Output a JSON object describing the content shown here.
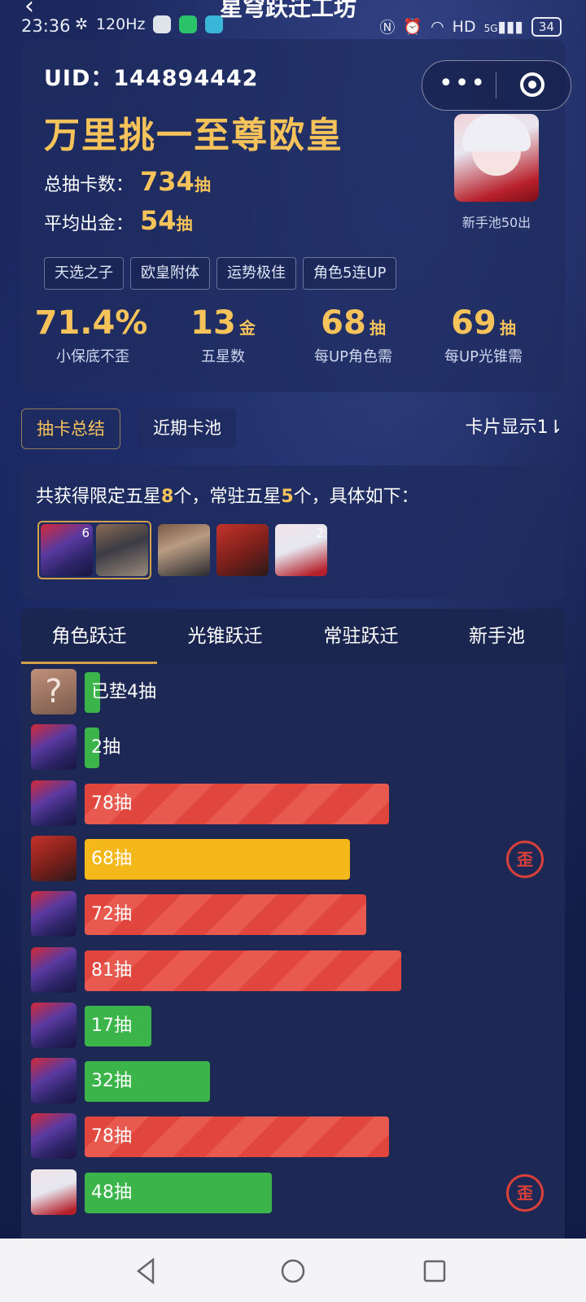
{
  "status_bar": {
    "time": "23:36",
    "refresh_rate": "120",
    "network": "5G",
    "battery": "34"
  },
  "header": {
    "title_partial": "星穹跃迁工坊"
  },
  "summary": {
    "uid_label": "UID：",
    "uid_value": "144894442",
    "rank_title": "万里挑一至尊欧皇",
    "total_pulls_label": "总抽卡数：",
    "total_pulls_value": "734",
    "total_pulls_unit": "抽",
    "avg_label": "平均出金：",
    "avg_value": "54",
    "avg_unit": "抽",
    "portrait_caption": "新手池50出",
    "tags": [
      "天选之子",
      "欧皇附体",
      "运势极佳",
      "角色5连UP"
    ],
    "metrics": [
      {
        "value": "71.4%",
        "unit": "",
        "label": "小保底不歪"
      },
      {
        "value": "13",
        "unit": "金",
        "label": "五星数"
      },
      {
        "value": "68",
        "unit": "抽",
        "label": "每UP角色需"
      },
      {
        "value": "69",
        "unit": "抽",
        "label": "每UP光锥需"
      }
    ]
  },
  "view_tabs": {
    "active": "抽卡总结",
    "other": "近期卡池",
    "card_display": "卡片显示1⇂"
  },
  "collection": {
    "text_prefix": "共获得限定五星",
    "limited_count": "8",
    "text_mid": "个，常驻五星",
    "standard_count": "5",
    "text_suffix": "个，具体如下：",
    "thumbs": [
      {
        "name": "seele",
        "badge": "6"
      },
      {
        "name": "lightcone",
        "badge": ""
      },
      {
        "name": "welt",
        "badge": ""
      },
      {
        "name": "himeko",
        "badge": ""
      },
      {
        "name": "white-hair",
        "badge": "2"
      }
    ]
  },
  "jump_tabs": [
    "角色跃迁",
    "光锥跃迁",
    "常驻跃迁",
    "新手池"
  ],
  "pulls": [
    {
      "label": "已垫4抽",
      "value": 4,
      "color": "green",
      "avatar": "unknown",
      "waive": false
    },
    {
      "label": "2抽",
      "value": 2,
      "color": "green",
      "avatar": "seele",
      "waive": false
    },
    {
      "label": "78抽",
      "value": 78,
      "color": "red",
      "avatar": "seele",
      "waive": false
    },
    {
      "label": "68抽",
      "value": 68,
      "color": "yellow",
      "avatar": "himeko",
      "waive": true
    },
    {
      "label": "72抽",
      "value": 72,
      "color": "red",
      "avatar": "seele",
      "waive": false
    },
    {
      "label": "81抽",
      "value": 81,
      "color": "red",
      "avatar": "seele",
      "waive": false
    },
    {
      "label": "17抽",
      "value": 17,
      "color": "green",
      "avatar": "seele",
      "waive": false
    },
    {
      "label": "32抽",
      "value": 32,
      "color": "green",
      "avatar": "seele",
      "waive": false
    },
    {
      "label": "78抽",
      "value": 78,
      "color": "red",
      "avatar": "seele",
      "waive": false
    },
    {
      "label": "48抽",
      "value": 48,
      "color": "green",
      "avatar": "white-hair",
      "waive": true
    }
  ],
  "waive_mark": "歪",
  "unknown_avatar_glyph": "?",
  "colors": {
    "gold": "#f6c35a",
    "red_bar": "#e0463d",
    "green_bar": "#3bb54a",
    "yellow_bar": "#f5b81b"
  }
}
